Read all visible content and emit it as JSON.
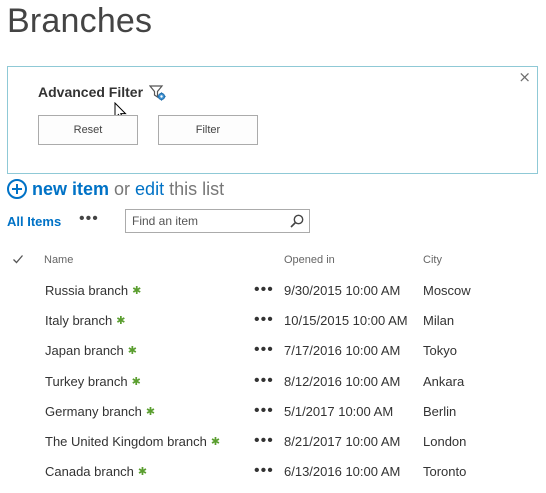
{
  "page": {
    "title": "Branches"
  },
  "filter_panel": {
    "title": "Advanced Filter",
    "close_label": "×",
    "reset_label": "Reset",
    "filter_label": "Filter"
  },
  "commands": {
    "new_item": "new item",
    "or": "or",
    "edit": "edit",
    "this_list": "this list"
  },
  "view": {
    "all_items": "All Items",
    "more": "•••",
    "search_placeholder": "Find an item"
  },
  "columns": {
    "name": "Name",
    "opened_in": "Opened in",
    "city": "City"
  },
  "rows": [
    {
      "name": "Russia branch",
      "opened": "9/30/2015 10:00 AM",
      "city": "Moscow"
    },
    {
      "name": "Italy branch",
      "opened": "10/15/2015 10:00 AM",
      "city": "Milan"
    },
    {
      "name": "Japan branch",
      "opened": "7/17/2016 10:00 AM",
      "city": "Tokyo"
    },
    {
      "name": "Turkey branch",
      "opened": "8/12/2016 10:00 AM",
      "city": "Ankara"
    },
    {
      "name": "Germany branch",
      "opened": "5/1/2017 10:00 AM",
      "city": "Berlin"
    },
    {
      "name": "The United Kingdom branch",
      "opened": "8/21/2017 10:00 AM",
      "city": "London"
    },
    {
      "name": "Canada branch",
      "opened": "6/13/2016 10:00 AM",
      "city": "Toronto"
    }
  ],
  "row_ui": {
    "new_marker": "✱",
    "more": "•••"
  },
  "icons": {
    "filter": "filter-gear-icon",
    "search": "search-icon",
    "plus": "plus-circle-icon",
    "check": "checkmark-icon"
  },
  "colors": {
    "accent": "#0072c6",
    "panel_border": "#8fc9d6",
    "new_marker": "#5a9e2f"
  }
}
